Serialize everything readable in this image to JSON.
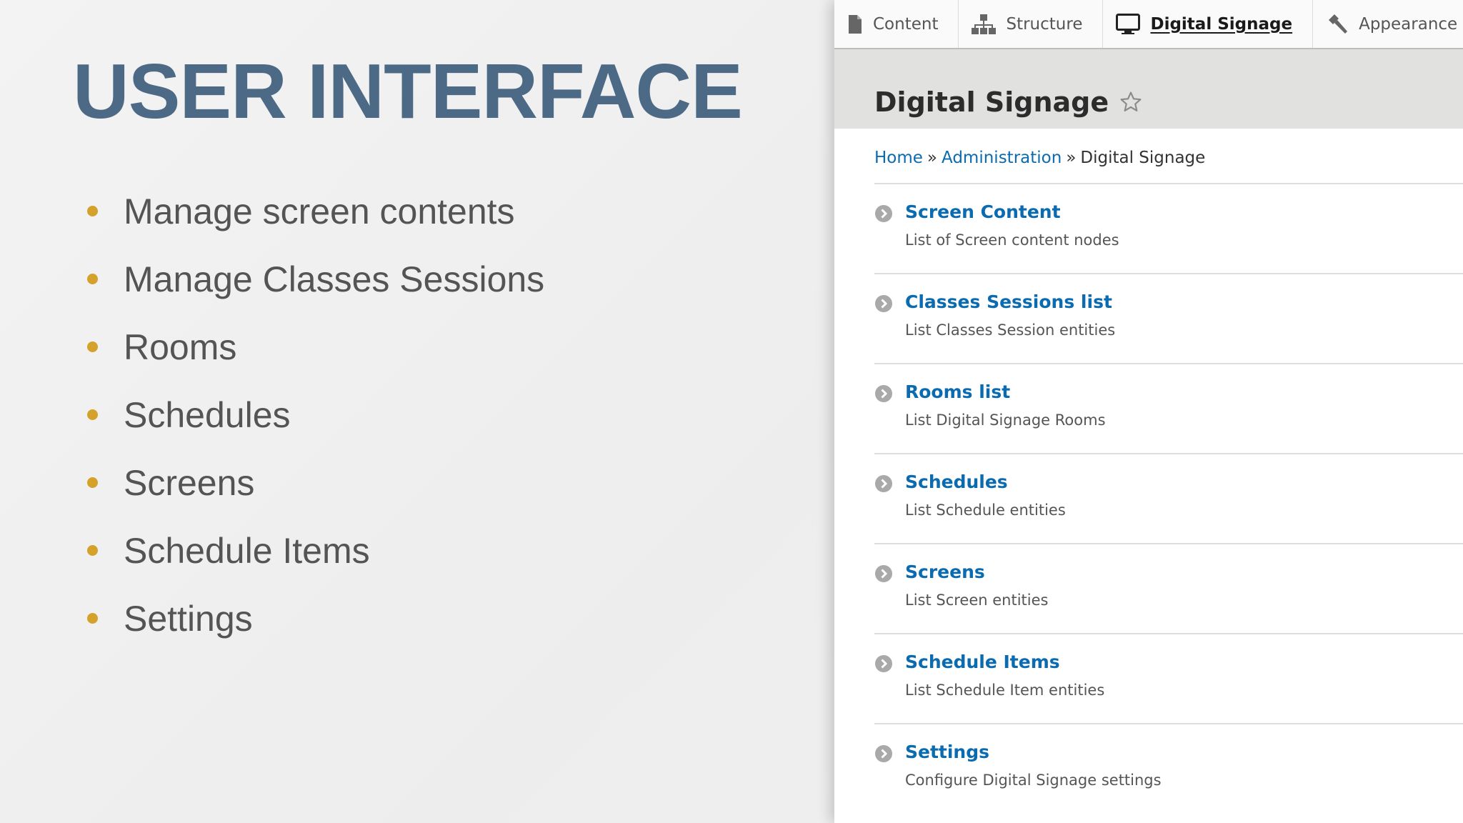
{
  "slide": {
    "title": "USER INTERFACE",
    "bullets": [
      "Manage screen contents",
      "Manage Classes Sessions",
      "Rooms",
      "Schedules",
      "Screens",
      "Schedule Items",
      "Settings"
    ],
    "colors": {
      "title": "#4c6a85",
      "bullet_dot": "#d4a12a",
      "bullet_text": "#545454"
    }
  },
  "toolbar": {
    "items": [
      {
        "label": "Content",
        "icon": "file-icon"
      },
      {
        "label": "Structure",
        "icon": "sitemap-icon"
      },
      {
        "label": "Digital Signage",
        "icon": "monitor-icon",
        "active": true
      },
      {
        "label": "Appearance",
        "icon": "paintbrush-icon"
      }
    ]
  },
  "page": {
    "title": "Digital Signage",
    "star_icon": "star-outline-icon"
  },
  "breadcrumb": {
    "home": "Home",
    "sep": "»",
    "administration": "Administration",
    "current": "Digital Signage"
  },
  "admin_items": [
    {
      "title": "Screen Content",
      "description": "List of Screen content nodes"
    },
    {
      "title": "Classes Sessions list",
      "description": "List Classes Session entities"
    },
    {
      "title": "Rooms list",
      "description": "List Digital Signage Rooms"
    },
    {
      "title": "Schedules",
      "description": "List Schedule entities"
    },
    {
      "title": "Screens",
      "description": "List Screen entities"
    },
    {
      "title": "Schedule Items",
      "description": "List Schedule Item entities"
    },
    {
      "title": "Settings",
      "description": "Configure Digital Signage settings"
    }
  ],
  "colors": {
    "link": "#0a6bb0",
    "header_bg": "#e1e1e0",
    "arrow_circle": "#a9a9a9"
  }
}
